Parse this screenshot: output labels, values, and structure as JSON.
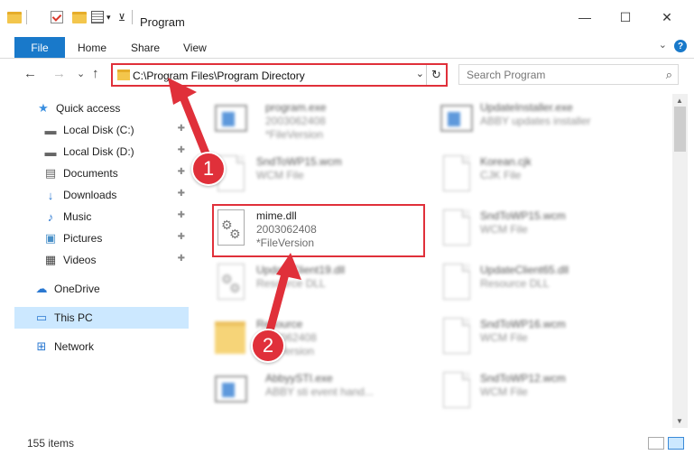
{
  "window": {
    "title": "Program",
    "minimize": "—",
    "maximize": "☐",
    "close": "✕"
  },
  "ribbon": {
    "file": "File",
    "home": "Home",
    "share": "Share",
    "view": "View",
    "help": "?",
    "collapse": "⌄"
  },
  "nav": {
    "back": "←",
    "forward": "→",
    "recent": "⌄",
    "up": "↑"
  },
  "address": {
    "path": "C:\\Program Files\\Program Directory",
    "dropdown": "⌄",
    "refresh": "↻"
  },
  "search": {
    "placeholder": "Search Program",
    "icon": "⌕"
  },
  "sidebar": {
    "items": [
      {
        "label": "Quick access",
        "icon": "star-icon",
        "glyph": "★",
        "color": "#3a8fe0",
        "pinned": false
      },
      {
        "label": "Local Disk (C:)",
        "icon": "drive-icon",
        "glyph": "▬",
        "color": "#666666",
        "pinned": true
      },
      {
        "label": "Local Disk (D:)",
        "icon": "drive-icon",
        "glyph": "▬",
        "color": "#666666",
        "pinned": true
      },
      {
        "label": "Documents",
        "icon": "documents-icon",
        "glyph": "▤",
        "color": "#666666",
        "pinned": true
      },
      {
        "label": "Downloads",
        "icon": "download-icon",
        "glyph": "↓",
        "color": "#2a78d1",
        "pinned": true
      },
      {
        "label": "Music",
        "icon": "music-icon",
        "glyph": "♪",
        "color": "#2a78d1",
        "pinned": true
      },
      {
        "label": "Pictures",
        "icon": "pictures-icon",
        "glyph": "▣",
        "color": "#4a90c8",
        "pinned": true
      },
      {
        "label": "Videos",
        "icon": "videos-icon",
        "glyph": "▦",
        "color": "#444444",
        "pinned": true
      },
      {
        "label": "OneDrive",
        "icon": "cloud-icon",
        "glyph": "☁",
        "color": "#2a78d1",
        "pinned": false
      },
      {
        "label": "This PC",
        "icon": "computer-icon",
        "glyph": "▭",
        "color": "#2a78d1",
        "pinned": false
      },
      {
        "label": "Network",
        "icon": "network-icon",
        "glyph": "⊞",
        "color": "#2a78d1",
        "pinned": false
      }
    ],
    "pin_glyph": "📌"
  },
  "files": [
    {
      "name": "program.exe",
      "sub1": "2003062408",
      "sub2": "*FileVersion",
      "kind": "exe"
    },
    {
      "name": "UpdateInstaller.exe",
      "sub1": "ABBY updates installer",
      "sub2": "",
      "kind": "app"
    },
    {
      "name": "SndToWP15.wcm",
      "sub1": "WCM File",
      "sub2": "",
      "kind": "file"
    },
    {
      "name": "Korean.cjk",
      "sub1": "CJK File",
      "sub2": "",
      "kind": "file"
    },
    {
      "name": "mime.dll",
      "sub1": "2003062408",
      "sub2": "*FileVersion",
      "kind": "dll"
    },
    {
      "name": "SndToWP15.wcm",
      "sub1": "WCM File",
      "sub2": "",
      "kind": "file"
    },
    {
      "name": "UpdateClient19.dll",
      "sub1": "Resource DLL",
      "sub2": "",
      "kind": "dll"
    },
    {
      "name": "UpdateClient65.dll",
      "sub1": "Resource DLL",
      "sub2": "",
      "kind": "file"
    },
    {
      "name": "Resource",
      "sub1": "2003062408",
      "sub2": "*FileVersion",
      "kind": "folder"
    },
    {
      "name": "SndToWP16.wcm",
      "sub1": "WCM File",
      "sub2": "",
      "kind": "file"
    },
    {
      "name": "AbbyySTI.exe",
      "sub1": "ABBY sti event hand...",
      "sub2": "",
      "kind": "app"
    },
    {
      "name": "SndToWP12.wcm",
      "sub1": "WCM File",
      "sub2": "",
      "kind": "file"
    }
  ],
  "annotations": {
    "badge1": "1",
    "badge2": "2",
    "accent": "#e0303a"
  },
  "status": {
    "items_count": "155 items"
  }
}
